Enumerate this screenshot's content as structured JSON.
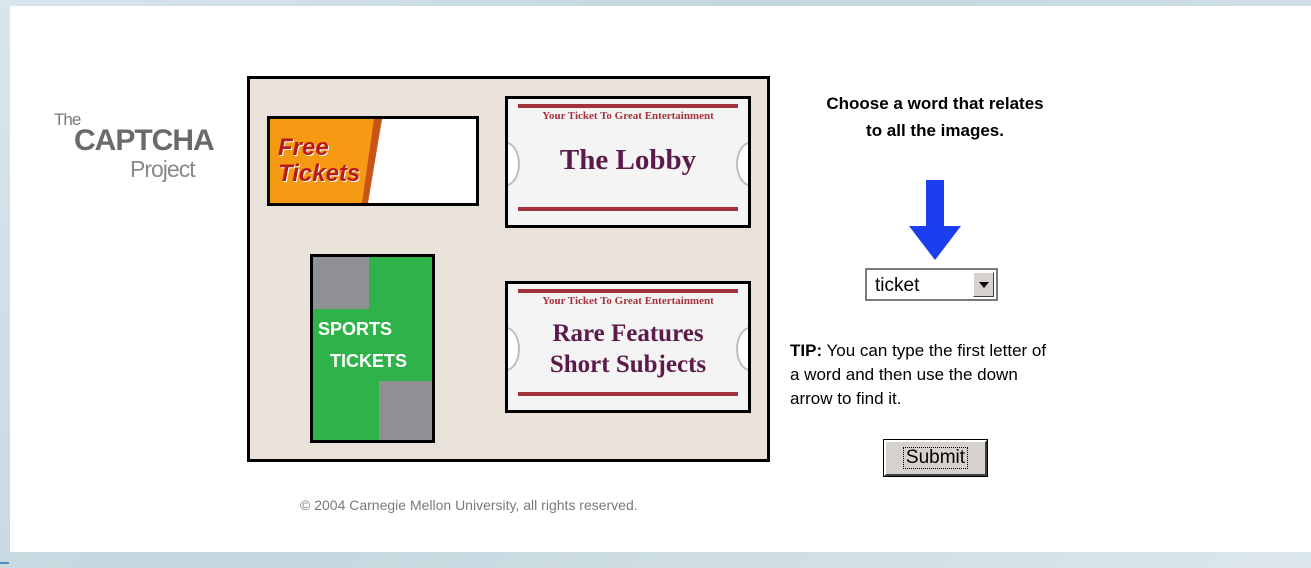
{
  "logo": {
    "the": "The",
    "captcha": "CAPTCHA",
    "project": "Project"
  },
  "images": {
    "free_tickets": {
      "line1": "Free",
      "line2": "Tickets"
    },
    "lobby": {
      "top": "Your Ticket To Great Entertainment",
      "main": "The Lobby"
    },
    "sports": {
      "line1": "SPORTS",
      "line2": "TICKETS"
    },
    "rare": {
      "top": "Your Ticket To Great Entertainment",
      "line1": "Rare Features",
      "line2": "Short Subjects"
    }
  },
  "instructions": {
    "line1": "Choose a word that relates",
    "line2": "to all the images."
  },
  "arrow_icon": "down-arrow-icon",
  "arrow_color": "#1a3ef0",
  "word_select": {
    "selected": "ticket"
  },
  "tip": {
    "label": "TIP:",
    "line1": " You can type the first letter of",
    "line2": "a word and then use the down",
    "line3": "arrow to find it."
  },
  "submit_label": "Submit",
  "copyright": "© 2004 Carnegie Mellon University, all rights reserved."
}
